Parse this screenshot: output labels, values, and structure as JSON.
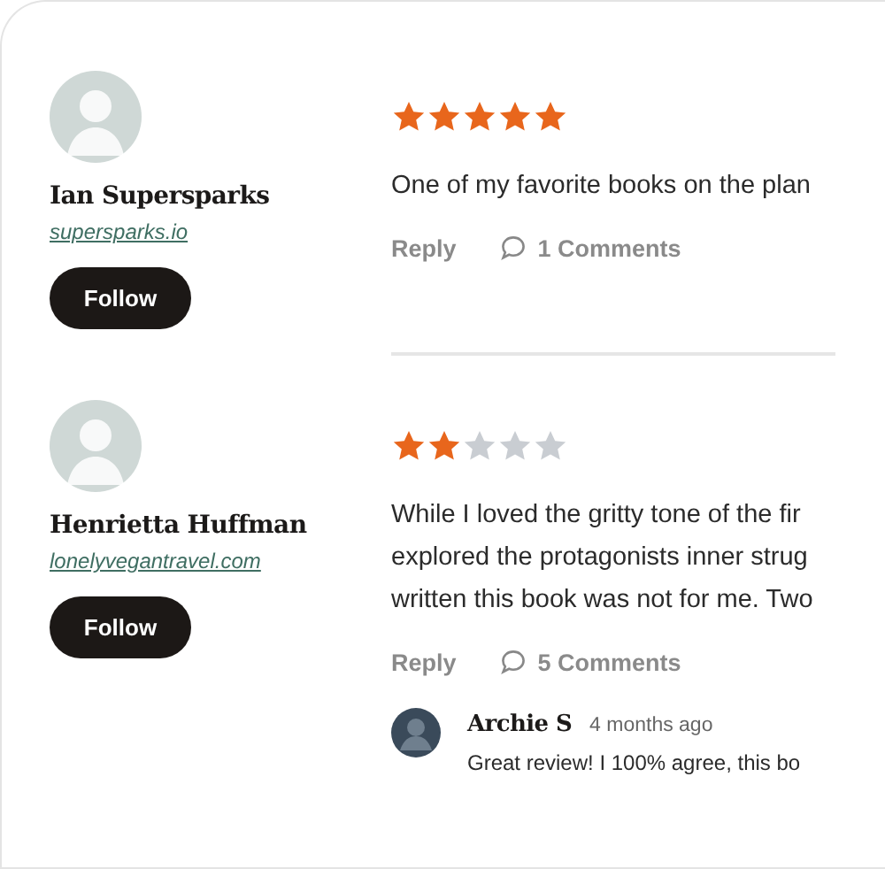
{
  "reviews": [
    {
      "user": {
        "name": "Ian Supersparks",
        "link": "supersparks.io",
        "follow": "Follow"
      },
      "stars": 5,
      "text_lines": [
        "One of my favorite books on the plan"
      ],
      "reply": "Reply",
      "comments": "1 Comments"
    },
    {
      "user": {
        "name": "Henrietta Huffman",
        "link": "lonelyvegantravel.com",
        "follow": "Follow"
      },
      "stars": 2,
      "text_lines": [
        "While I loved the gritty tone of the fir",
        "explored the protagonists inner strug",
        "written this book was not for me. Two"
      ],
      "reply": "Reply",
      "comments": "5 Comments",
      "replies": [
        {
          "name": "Archie S",
          "time": "4 months ago",
          "text": "Great review! I 100% agree, this bo"
        }
      ]
    }
  ]
}
